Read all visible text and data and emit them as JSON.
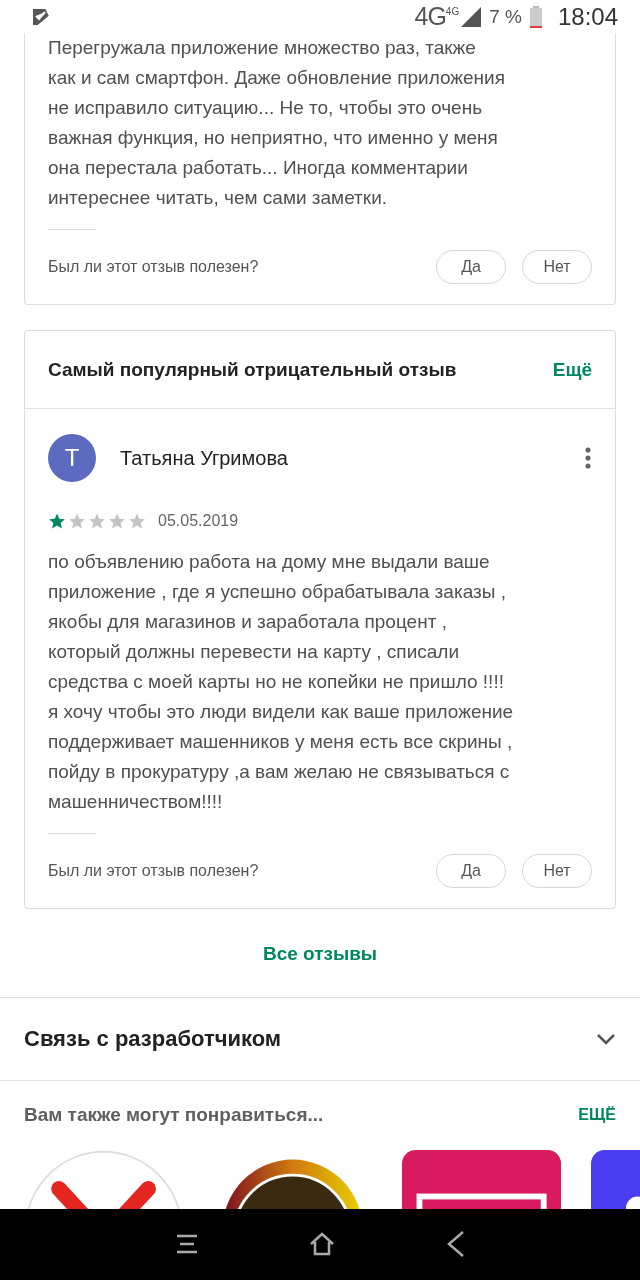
{
  "status_bar": {
    "network": "4G",
    "network_badge": "4G",
    "battery": "7 %",
    "time": "18:04"
  },
  "previous_review": {
    "text": "Перегружала приложение множество раз, также\nкак и сам смартфон. Даже обновление приложения\nне исправило ситуацию... Не то, чтобы это очень\nважная функция, но неприятно, что именно у меня\nона перестала работать... Иногда комментарии\nинтереснее читать, чем сами заметки.",
    "helpful_question": "Был ли этот отзыв полезен?",
    "buttons": [
      "Да",
      "Нет"
    ]
  },
  "negative_review": {
    "title": "Самый популярный отрицательный отзыв",
    "more": "Ещё",
    "avatar_letter": "Т",
    "author": "Татьяна Угримова",
    "stars": 1,
    "date": "05.05.2019",
    "text": "по объявлению работа на дому мне выдали ваше\nприложение , где я успешно обрабатывала заказы ,\nякобы для магазинов и заработала процент ,\nкоторый должны перевести на карту , списали\nсредства с моей карты но не копейки не пришло !!!!\nя хочу чтобы это люди видели как ваше приложение\nподдерживает машенников у меня есть все скрины ,\nпойду в прокуратуру ,а вам желаю не связываться с\nмашенничеством!!!!",
    "helpful_question": "Был ли этот отзыв полезен?",
    "buttons": [
      "Да",
      "Нет"
    ]
  },
  "all_reviews": "Все отзывы",
  "developer_contact": {
    "title": "Связь с разработчиком",
    "expanded": false
  },
  "recommendations": {
    "title": "Вам также могут понравиться...",
    "more": "ЕЩЁ",
    "apps": [
      {
        "kind": "cross"
      },
      {
        "kind": "ring"
      },
      {
        "kind": "frame"
      },
      {
        "kind": "tile"
      }
    ]
  }
}
